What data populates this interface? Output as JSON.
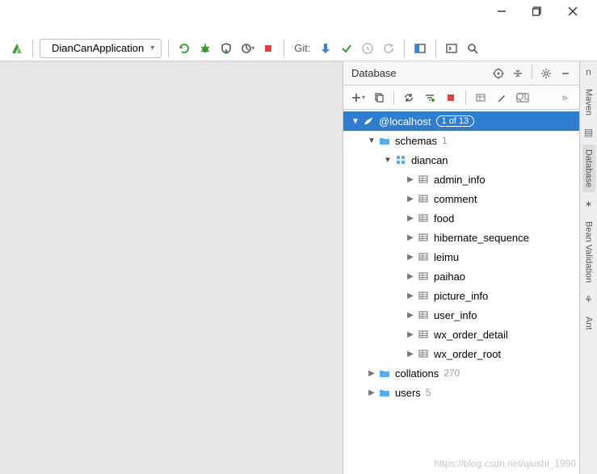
{
  "window": {
    "minimize": "–",
    "maximize": "❐",
    "close": "✕"
  },
  "toolbar": {
    "run_config": "DianCanApplication",
    "git_label": "Git:"
  },
  "side_tabs": {
    "maven": "Maven",
    "database": "Database",
    "bean_validation": "Bean Validation",
    "ant": "Ant"
  },
  "db_panel": {
    "title": "Database",
    "root": {
      "label": "@localhost",
      "badge": "1 of 13"
    },
    "schemas": {
      "label": "schemas",
      "count": "1"
    },
    "diancan": {
      "label": "diancan"
    },
    "tables": [
      "admin_info",
      "comment",
      "food",
      "hibernate_sequence",
      "leimu",
      "paihao",
      "picture_info",
      "user_info",
      "wx_order_detail",
      "wx_order_root"
    ],
    "collations": {
      "label": "collations",
      "count": "270"
    },
    "users": {
      "label": "users",
      "count": "5"
    }
  },
  "watermark": "https://blog.csdn.net/qiushi_1990"
}
